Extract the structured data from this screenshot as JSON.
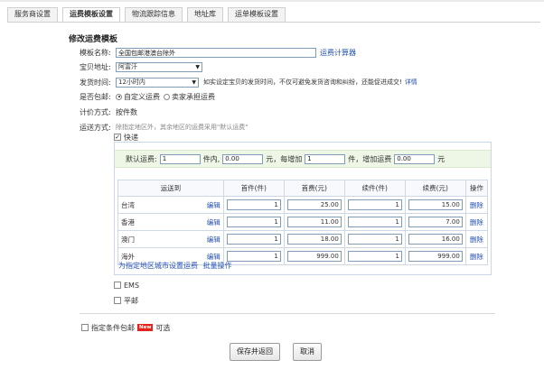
{
  "tabs": [
    "服务商设置",
    "运费模板设置",
    "物流跟踪信息",
    "地址库",
    "运单模板设置"
  ],
  "active_tab": 1,
  "section_title": "修改运费模板",
  "form": {
    "name_label": "模板名称:",
    "name_value": "全国包邮港澳台除外",
    "calc_link": "运费计算器",
    "address_label": "宝贝地址:",
    "address_value": "阿富汗",
    "ship_time_label": "发货时间:",
    "ship_time_value": "12小时内",
    "ship_time_hint": "如实设定宝贝的发货时间，不仅可避免发货咨询和纠纷，还能促进成交!",
    "detail_link": "详情",
    "free_label": "是否包邮:",
    "free_options": [
      "自定义运费",
      "卖家承担运费"
    ],
    "pricing_label": "计价方式:",
    "pricing_value": "按件数",
    "method_label": "运送方式:",
    "method_hint": "除指定地区外，其余地区的运费采用\"默认运费\""
  },
  "express": {
    "label": "快递",
    "default_label": "默认运费:",
    "first_qty": "1",
    "unit_within": "件内,",
    "first_fee": "0.00",
    "yuan_each": "元，每增加",
    "add_qty": "1",
    "unit_add": "件，增加运费",
    "add_fee": "0.00",
    "yuan": "元",
    "columns": [
      "运送到",
      "首件(件)",
      "首费(元)",
      "续件(件)",
      "续费(元)",
      "操作"
    ],
    "edit_label": "编辑",
    "delete_label": "删除",
    "rows": [
      {
        "region": "台湾",
        "first": "1",
        "first_fee": "25.00",
        "next": "1",
        "next_fee": "15.00"
      },
      {
        "region": "香港",
        "first": "1",
        "first_fee": "11.00",
        "next": "1",
        "next_fee": "7.00"
      },
      {
        "region": "澳门",
        "first": "1",
        "first_fee": "18.00",
        "next": "1",
        "next_fee": "16.00"
      },
      {
        "region": "海外",
        "first": "1",
        "first_fee": "999.00",
        "next": "1",
        "next_fee": "999.00"
      }
    ],
    "footer_link": "为指定地区城市设置运费",
    "batch_link": "批量操作"
  },
  "other_methods": [
    "EMS",
    "平邮"
  ],
  "condition": {
    "label": "指定条件包邮",
    "badge": "New",
    "optional": "可选"
  },
  "buttons": {
    "save": "保存并返回",
    "cancel": "取消"
  }
}
